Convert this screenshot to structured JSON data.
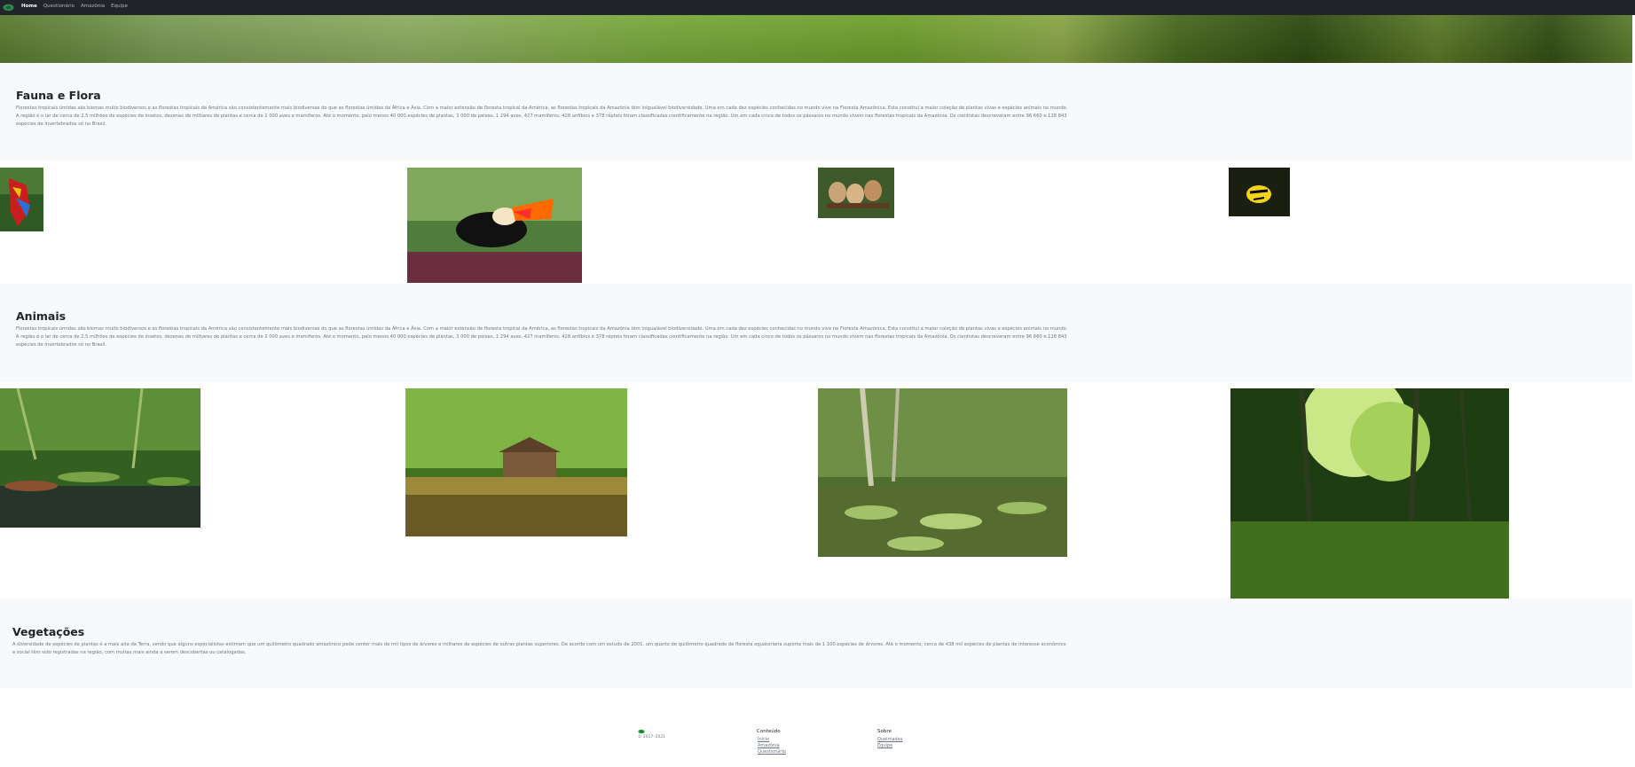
{
  "navbar": {
    "links": [
      "Home",
      "Questionário",
      "Amazônia",
      "Equipe"
    ]
  },
  "sections": {
    "fauna_flora": {
      "title": "Fauna e Flora",
      "text": "Florestas tropicais úmidas são biomas muito biodiversos e as florestas tropicais da América são consistentemente mais biodiversas do que as florestas úmidas da África e Ásia. Com a maior extensão de floresta tropical da América, as florestas tropicais da Amazônia têm inigualável biodiversidade. Uma em cada dez espécies conhecidas no mundo vive na Floresta Amazônica. Esta constitui a maior coleção de plantas vivas e espécies animais no mundo. A região é o lar de cerca de 2,5 milhões de espécies de insetos, dezenas de milhares de plantas e cerca de 2 000 aves e mamíferos. Até o momento, pelo menos 40 000 espécies de plantas, 3 000 de peixes, 1 294 aves, 427 mamíferos, 428 anfíbios e 378 répteis foram classificadas cientificamente na região. Um em cada cinco de todos os pássaros no mundo vivem nas florestas tropicais da Amazônia. Os cientistas descreveram entre 96 660 e 128 843 espécies de invertebrados só no Brasil."
    },
    "animais": {
      "title": "Animais",
      "text": "Florestas tropicais úmidas são biomas muito biodiversos e as florestas tropicais da América são consistentemente mais biodiversas do que as florestas úmidas da África e Ásia. Com a maior extensão de floresta tropical da América, as florestas tropicais da Amazônia têm inigualável biodiversidade. Uma em cada dez espécies conhecidas no mundo vive na Floresta Amazônica. Esta constitui a maior coleção de plantas vivas e espécies animais no mundo. A região é o lar de cerca de 2,5 milhões de espécies de insetos, dezenas de milhares de plantas e cerca de 2 000 aves e mamíferos. Até o momento, pelo menos 40 000 espécies de plantas, 3 000 de peixes, 1 294 aves, 427 mamíferos, 428 anfíbios e 378 répteis foram classificadas cientificamente na região. Um em cada cinco de todos os pássaros no mundo vivem nas florestas tropicais da Amazônia. Os cientistas descreveram entre 96 660 e 128 843 espécies de invertebrados só no Brasil."
    },
    "vegetacoes": {
      "title": "Vegetações",
      "text": "A diversidade de espécies de plantas é a mais alta da Terra, sendo que alguns especialistas estimam que um quilômetro quadrado amazônico pode conter mais de mil tipos de árvores e milhares de espécies de outras plantas superiores. De acordo com um estudo de 2001, um quarto de quilômetro quadrado de floresta equatoriana suporta mais de 1 100 espécies de árvores. Até o momento, cerca de 438 mil espécies de plantas de interesse econômico e social têm sido registradas na região, com muitas mais ainda a serem descobertas ou catalogadas."
    }
  },
  "footer": {
    "copyright": "© 2017–2021",
    "columns": [
      {
        "title": "Conteúdo",
        "links": [
          "Início",
          "Amazônia",
          "Questionário"
        ]
      },
      {
        "title": "Sobre",
        "links": [
          "Queimadas",
          "Equipe"
        ]
      }
    ]
  },
  "colors": {
    "navbar": "#212529",
    "section_bg": "#f8f9fa",
    "logo_green": "#28a745"
  }
}
